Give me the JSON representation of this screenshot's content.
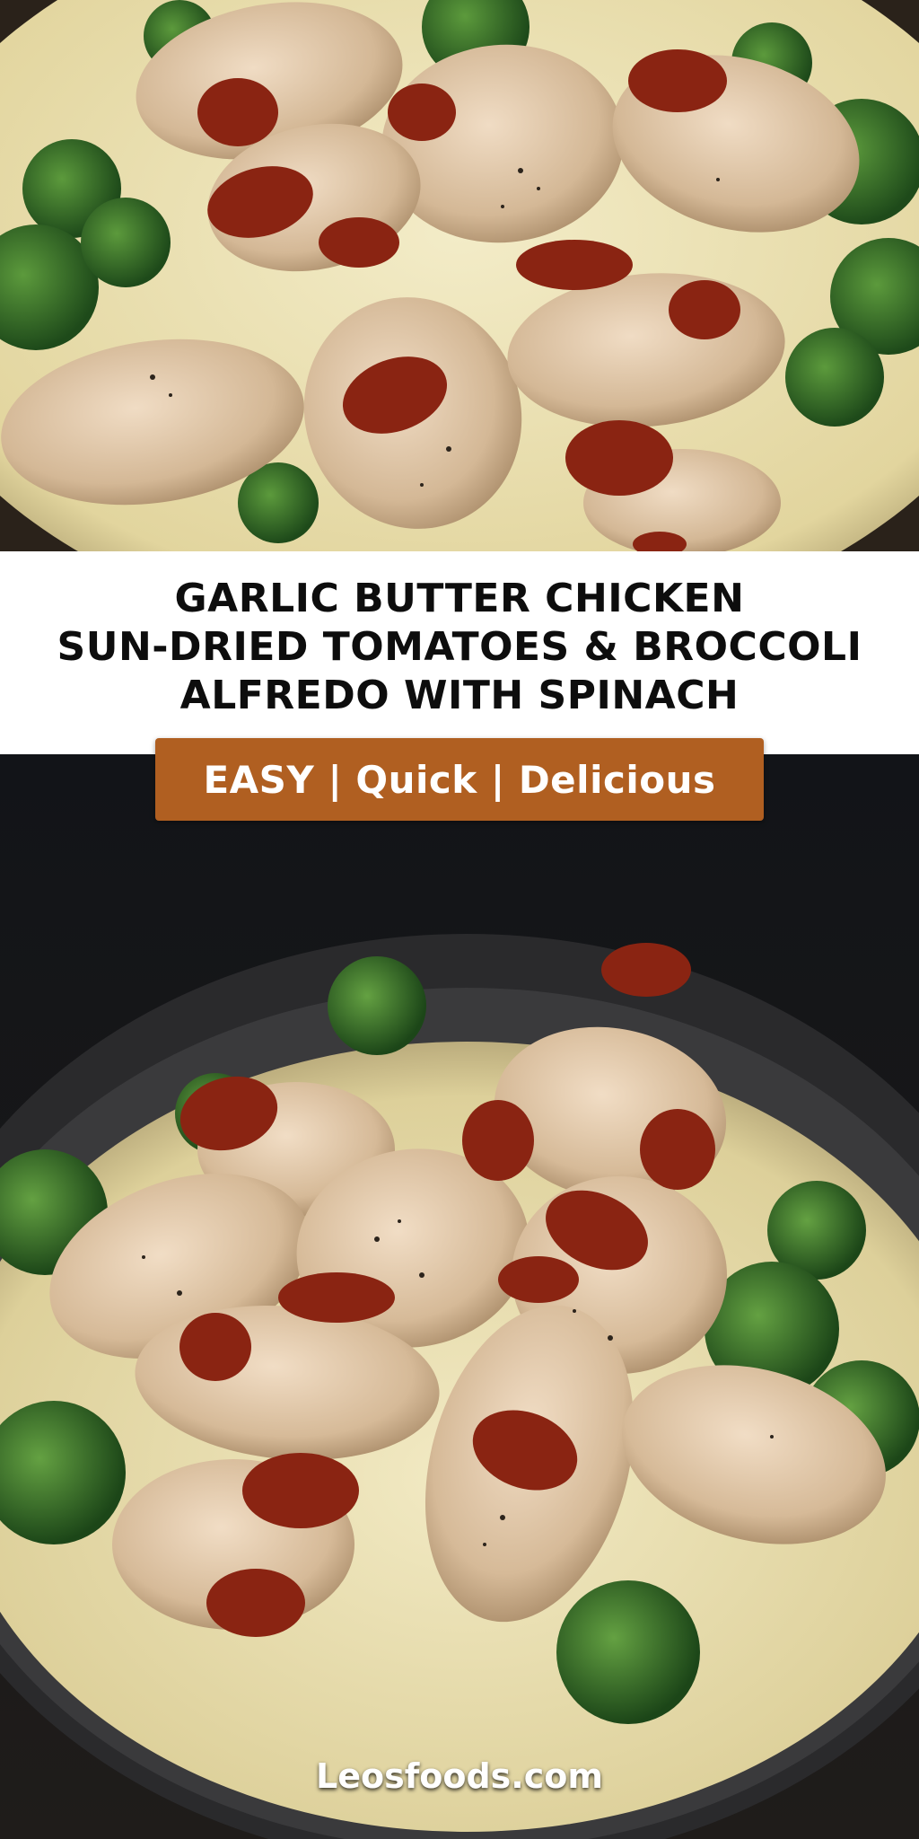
{
  "title": {
    "line1": "GARLIC BUTTER CHICKEN",
    "line2": "SUN-DRIED TOMATOES & BROCCOLI",
    "line3": "ALFREDO WITH SPINACH"
  },
  "tagline": "EASY | Quick | Delicious",
  "site": "Leosfoods.com",
  "colors": {
    "badge": "#b05f21",
    "title_band": "#ffffff",
    "title_text": "#0d0d0d",
    "cream_sauce": "#ece3b8",
    "chicken": "#dcc3a4",
    "broccoli": "#2f6b2a",
    "sun_dried_tomato": "#8a2412",
    "pan": "#2a2a2c"
  },
  "images": {
    "top": "chicken-alfredo-closeup",
    "bottom": "chicken-alfredo-in-pan"
  }
}
